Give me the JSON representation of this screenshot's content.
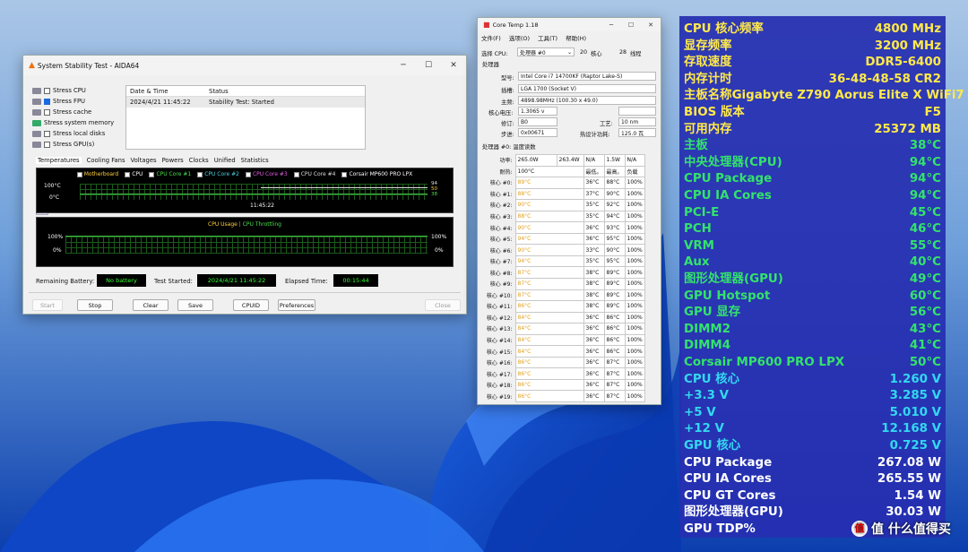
{
  "aida": {
    "title": "System Stability Test - AIDA64",
    "stress_items": [
      {
        "label": "Stress CPU",
        "checked": false
      },
      {
        "label": "Stress FPU",
        "checked": true
      },
      {
        "label": "Stress cache",
        "checked": false
      },
      {
        "label": "Stress system memory",
        "checked": false
      },
      {
        "label": "Stress local disks",
        "checked": false
      },
      {
        "label": "Stress GPU(s)",
        "checked": false
      }
    ],
    "log_headers": [
      "Date & Time",
      "Status"
    ],
    "log_row": [
      "2024/4/21 11:45:22",
      "Stability Test: Started"
    ],
    "tabs": [
      "Temperatures",
      "Cooling Fans",
      "Voltages",
      "Powers",
      "Clocks",
      "Unified",
      "Statistics"
    ],
    "legend": [
      "Motherboard",
      "CPU",
      "CPU Core #1",
      "CPU Core #2",
      "CPU Core #3",
      "CPU Core #4",
      "Corsair MP600 PRO LPX"
    ],
    "temp_top": "100°C",
    "temp_bottom": "0°C",
    "temp_vals": [
      "94",
      "50",
      "38"
    ],
    "time_label": "11:45:22",
    "usage_title": "CPU Usage",
    "throttle_title": "CPU Throttling",
    "usage_top": "100%",
    "usage_bottom": "0%",
    "usage_right_top": "100%",
    "usage_right_bottom": "0%",
    "battery_label": "Remaining Battery:",
    "battery_value": "No battery",
    "started_label": "Test Started:",
    "started_value": "2024/4/21 11:45:22",
    "elapsed_label": "Elapsed Time:",
    "elapsed_value": "00:15:44",
    "buttons": {
      "start": "Start",
      "stop": "Stop",
      "clear": "Clear",
      "save": "Save",
      "cpuid": "CPUID",
      "preferences": "Preferences",
      "close": "Close"
    }
  },
  "coretemp": {
    "title": "Core Temp 1.18",
    "menu": [
      "文件(F)",
      "选项(O)",
      "工具(T)",
      "帮助(H)"
    ],
    "select_label": "选择 CPU:",
    "select_value": "处理器 #0",
    "cores": "20",
    "cores_label": "核心",
    "threads": "28",
    "threads_label": "线程",
    "processor_header": "处理器",
    "model_label": "型号:",
    "model_value": "Intel Core i7 14700KF (Raptor Lake-S)",
    "platform_label": "插槽:",
    "platform_value": "LGA 1700 (Socket V)",
    "freq_label": "主频:",
    "freq_value": "4898.98MHz (100.30 x 49.0)",
    "vid_label": "核心电压:",
    "vid_value": "1.3065 v",
    "rev_label": "修订:",
    "rev_value": "B0",
    "lith_label": "工艺:",
    "lith_value": "10 nm",
    "step_label": "步进:",
    "step_value": "0x00671",
    "tdp_label": "热设计功耗:",
    "tdp_value": "125.0 瓦",
    "readings_header": "处理器 #0: 温度读数",
    "power_label": "功率:",
    "power_vals": [
      "265.0W",
      "263.4W",
      "N/A",
      "1.5W",
      "N/A"
    ],
    "tj_label": "耐热:",
    "tj_value": "100°C",
    "col_headers": [
      "最低。",
      "最高。",
      "负载"
    ],
    "core_rows": [
      {
        "label": "核心 #0:",
        "cur": "89°C",
        "min": "36°C",
        "max": "88°C",
        "load": "100%"
      },
      {
        "label": "核心 #1:",
        "cur": "88°C",
        "min": "37°C",
        "max": "90°C",
        "load": "100%"
      },
      {
        "label": "核心 #2:",
        "cur": "90°C",
        "min": "35°C",
        "max": "92°C",
        "load": "100%"
      },
      {
        "label": "核心 #3:",
        "cur": "88°C",
        "min": "35°C",
        "max": "94°C",
        "load": "100%"
      },
      {
        "label": "核心 #4:",
        "cur": "90°C",
        "min": "36°C",
        "max": "93°C",
        "load": "100%"
      },
      {
        "label": "核心 #5:",
        "cur": "94°C",
        "min": "36°C",
        "max": "95°C",
        "load": "100%"
      },
      {
        "label": "核心 #6:",
        "cur": "90°C",
        "min": "33°C",
        "max": "90°C",
        "load": "100%"
      },
      {
        "label": "核心 #7:",
        "cur": "94°C",
        "min": "35°C",
        "max": "95°C",
        "load": "100%"
      },
      {
        "label": "核心 #8:",
        "cur": "87°C",
        "min": "38°C",
        "max": "89°C",
        "load": "100%"
      },
      {
        "label": "核心 #9:",
        "cur": "87°C",
        "min": "38°C",
        "max": "89°C",
        "load": "100%"
      },
      {
        "label": "核心 #10:",
        "cur": "87°C",
        "min": "38°C",
        "max": "89°C",
        "load": "100%"
      },
      {
        "label": "核心 #11:",
        "cur": "86°C",
        "min": "38°C",
        "max": "89°C",
        "load": "100%"
      },
      {
        "label": "核心 #12:",
        "cur": "84°C",
        "min": "36°C",
        "max": "86°C",
        "load": "100%"
      },
      {
        "label": "核心 #13:",
        "cur": "84°C",
        "min": "36°C",
        "max": "86°C",
        "load": "100%"
      },
      {
        "label": "核心 #14:",
        "cur": "84°C",
        "min": "36°C",
        "max": "86°C",
        "load": "100%"
      },
      {
        "label": "核心 #15:",
        "cur": "84°C",
        "min": "36°C",
        "max": "86°C",
        "load": "100%"
      },
      {
        "label": "核心 #16:",
        "cur": "86°C",
        "min": "36°C",
        "max": "87°C",
        "load": "100%"
      },
      {
        "label": "核心 #17:",
        "cur": "86°C",
        "min": "36°C",
        "max": "87°C",
        "load": "100%"
      },
      {
        "label": "核心 #18:",
        "cur": "86°C",
        "min": "36°C",
        "max": "87°C",
        "load": "100%"
      },
      {
        "label": "核心 #19:",
        "cur": "86°C",
        "min": "36°C",
        "max": "87°C",
        "load": "100%"
      }
    ]
  },
  "osd": {
    "rows": [
      {
        "k": "CPU 核心频率",
        "v": "4800 MHz",
        "yellow": true
      },
      {
        "k": "显存频率",
        "v": "3200 MHz",
        "yellow": true
      },
      {
        "k": "存取速度",
        "v": "DDR5-6400",
        "yellow": true
      },
      {
        "k": "内存计时",
        "v": "36-48-48-58 CR2",
        "yellow": true
      },
      {
        "k": "主板名称",
        "v": "Gigabyte Z790 Aorus Elite X WiFi7",
        "yellow": true
      },
      {
        "k": "BIOS 版本",
        "v": "F5",
        "yellow": true
      },
      {
        "k": "可用内存",
        "v": "25372 MB",
        "yellow": true
      },
      {
        "k": "主板",
        "v": "38°C"
      },
      {
        "k": "中央处理器(CPU)",
        "v": "94°C"
      },
      {
        "k": "CPU Package",
        "v": "94°C"
      },
      {
        "k": "CPU IA Cores",
        "v": "94°C"
      },
      {
        "k": "PCI-E",
        "v": "45°C"
      },
      {
        "k": "PCH",
        "v": "46°C"
      },
      {
        "k": "VRM",
        "v": "55°C"
      },
      {
        "k": "Aux",
        "v": "40°C"
      },
      {
        "k": "图形处理器(GPU)",
        "v": "49°C"
      },
      {
        "k": "GPU Hotspot",
        "v": "60°C"
      },
      {
        "k": "GPU 显存",
        "v": "56°C"
      },
      {
        "k": "DIMM2",
        "v": "43°C"
      },
      {
        "k": "DIMM4",
        "v": "41°C"
      },
      {
        "k": "Corsair MP600 PRO LPX",
        "v": "50°C"
      },
      {
        "k": "CPU 核心",
        "v": "1.260 V",
        "blue": true
      },
      {
        "k": "+3.3 V",
        "v": "3.285 V",
        "blue": true
      },
      {
        "k": "+5 V",
        "v": "5.010 V",
        "blue": true
      },
      {
        "k": "+12 V",
        "v": "12.168 V",
        "blue": true
      },
      {
        "k": "GPU 核心",
        "v": "0.725 V",
        "blue": true
      },
      {
        "k": "CPU Package",
        "v": "267.08 W",
        "white": true
      },
      {
        "k": "CPU IA Cores",
        "v": "265.55 W",
        "white": true
      },
      {
        "k": "CPU GT Cores",
        "v": "1.54 W",
        "white": true
      },
      {
        "k": "图形处理器(GPU)",
        "v": "30.03 W",
        "white": true
      },
      {
        "k": "GPU TDP%",
        "v": "",
        "white": true
      }
    ]
  },
  "watermark": "值 什么值得买"
}
